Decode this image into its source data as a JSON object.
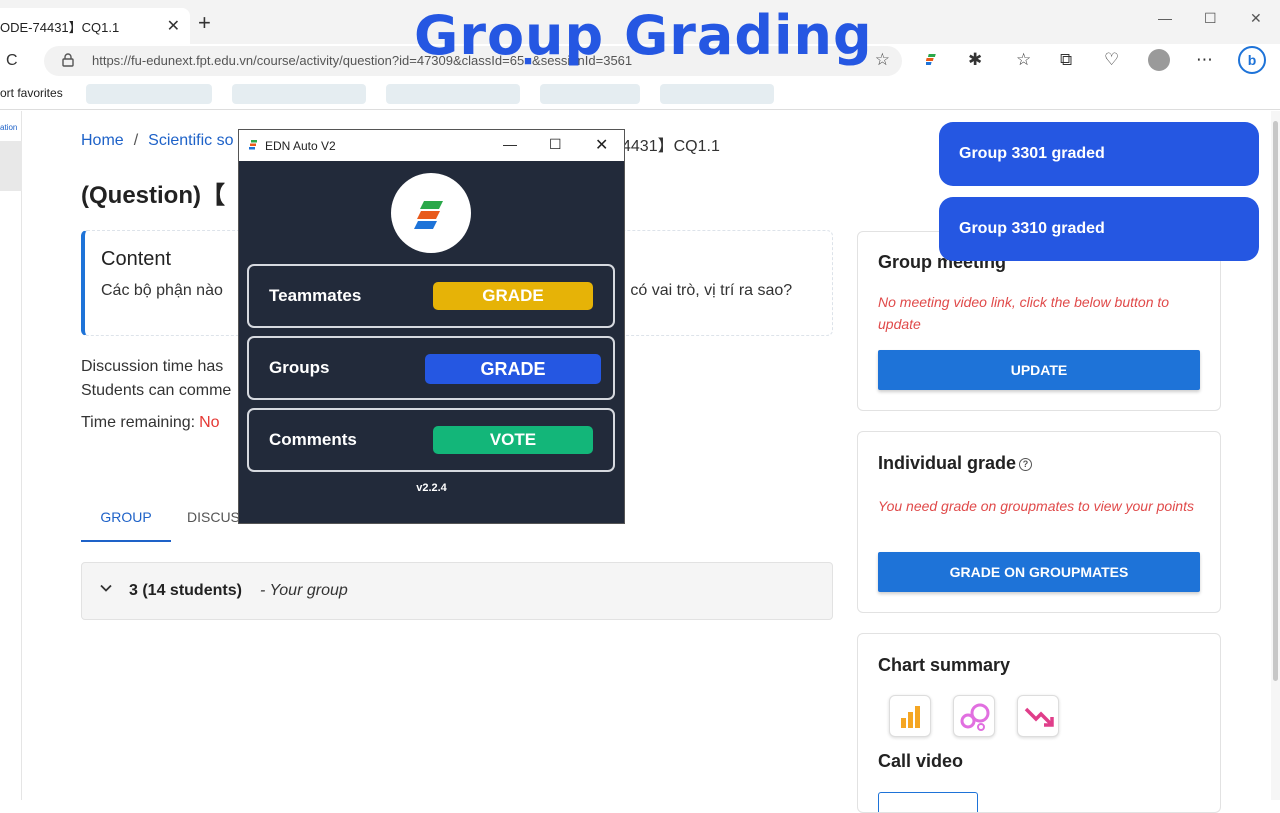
{
  "browser": {
    "tab_title": "ODE-74431】CQ1.1",
    "url": "https://fu-edunext.fpt.edu.vn/course/activity/question?id=47309&classId=65",
    "url_tail": "sessionId=3561",
    "favorites_label": "ort favorites"
  },
  "overlay": {
    "title": "Group Grading"
  },
  "page": {
    "rail_label": "ation",
    "breadcrumb": {
      "home": "Home",
      "second": "Scientific so",
      "tail": "4431】CQ1.1"
    },
    "question_title": "(Question)【",
    "content": {
      "title": "Content",
      "text": "Các bộ phận nào",
      "text_tail": "n có vai trò, vị trí ra sao?"
    },
    "discussion_line1": "Discussion time has",
    "discussion_line2": "Students can comme",
    "time_remaining_label": "Time remaining:",
    "time_remaining_value": "No",
    "tabs": {
      "group": "GROUP",
      "discussion": "DISCUS"
    },
    "group_row": {
      "label": "3  (14 students)",
      "sub": "- Your group"
    }
  },
  "cards": {
    "meeting": {
      "title": "Group meeting",
      "warning": "No meeting video link, click the below button to update",
      "button": "UPDATE"
    },
    "individual": {
      "title": "Individual grade",
      "help": "?",
      "warning": "You need grade on groupmates to view your points",
      "button": "GRADE ON GROUPMATES"
    },
    "chart": {
      "title": "Chart summary",
      "call_video": "Call video"
    }
  },
  "toasts": [
    "Group 3301 graded",
    "Group 3310 graded"
  ],
  "popup": {
    "title": "EDN Auto V2",
    "rows": [
      {
        "label": "Teammates",
        "button": "GRADE",
        "color": "#e6b307"
      },
      {
        "label": "Groups",
        "button": "GRADE",
        "color": "#2557e2"
      },
      {
        "label": "Comments",
        "button": "VOTE",
        "color": "#13b679"
      }
    ],
    "version": "v2.2.4"
  },
  "colors": {
    "accent": "#1e73d8",
    "toast": "#2557e2",
    "warning": "#e04a4a",
    "popup_bg": "#222a3a"
  }
}
